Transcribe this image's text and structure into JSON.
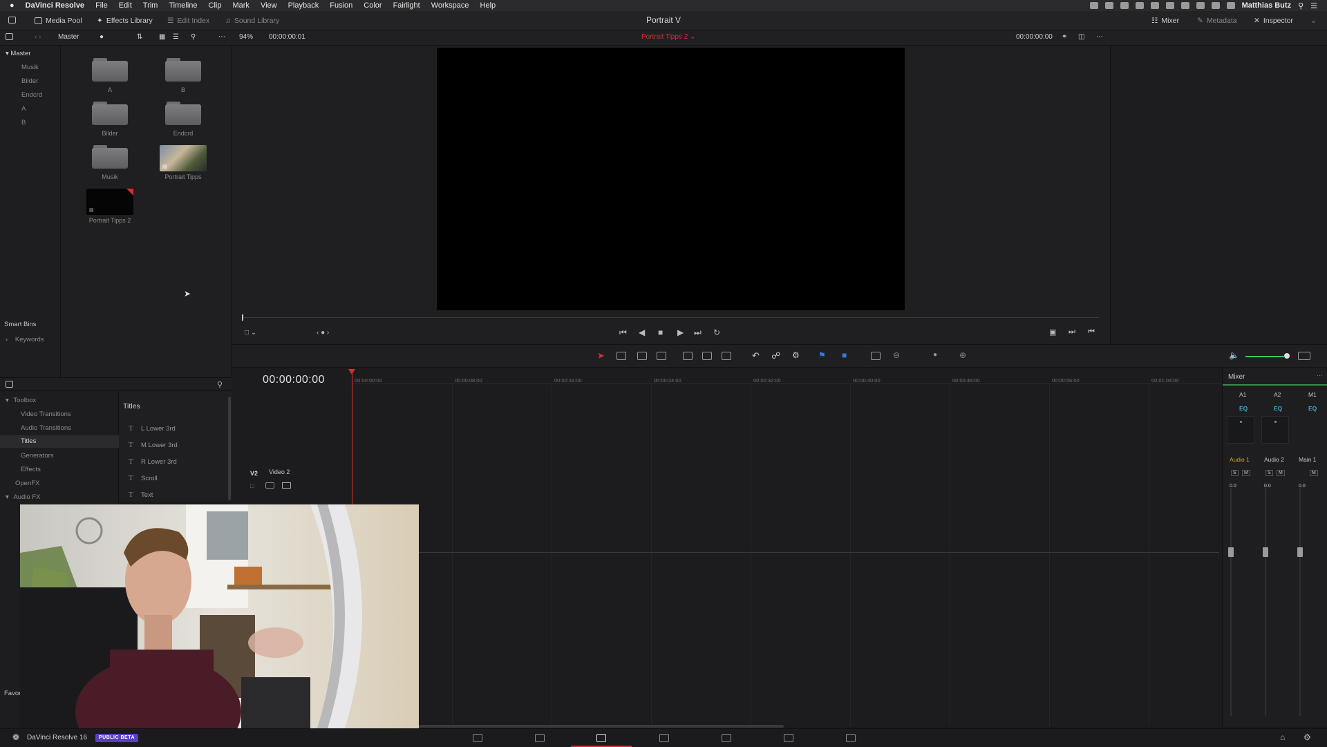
{
  "menubar": {
    "apple": "",
    "app": "DaVinci Resolve",
    "items": [
      "File",
      "Edit",
      "Trim",
      "Timeline",
      "Clip",
      "Mark",
      "View",
      "Playback",
      "Fusion",
      "Color",
      "Fairlight",
      "Workspace",
      "Help"
    ],
    "user": "Matthias Butz"
  },
  "topbar": {
    "media_pool": "Media Pool",
    "effects_library": "Effects Library",
    "edit_index": "Edit Index",
    "sound_library": "Sound Library",
    "project_title": "Portrait V",
    "mixer": "Mixer",
    "metadata": "Metadata",
    "inspector": "Inspector"
  },
  "subbar": {
    "bin_name": "Master",
    "zoom": "94%",
    "source_tc": "00:00:00:01",
    "timeline_name": "Portrait Tipps 2",
    "record_tc": "00:00:00:00"
  },
  "bins": {
    "master": "Master",
    "children": [
      "Musik",
      "Bilder",
      "Endcrd",
      "A",
      "B"
    ],
    "smart_bins": "Smart Bins",
    "keywords": "Keywords"
  },
  "clips": [
    {
      "label": "A",
      "kind": "folder"
    },
    {
      "label": "B",
      "kind": "folder"
    },
    {
      "label": "Bilder",
      "kind": "folder"
    },
    {
      "label": "Endcrd",
      "kind": "folder"
    },
    {
      "label": "Musik",
      "kind": "folder"
    },
    {
      "label": "Portrait Tipps",
      "kind": "video"
    },
    {
      "label": "Portrait Tipps 2",
      "kind": "timeline"
    }
  ],
  "effects": {
    "toolbox": "Toolbox",
    "video_transitions": "Video Transitions",
    "audio_transitions": "Audio Transitions",
    "titles": "Titles",
    "generators": "Generators",
    "effects": "Effects",
    "openfx": "OpenFX",
    "audio_fx": "Audio FX",
    "favorites": "Favor",
    "list_header": "Titles",
    "title_items": [
      "L Lower 3rd",
      "M Lower 3rd",
      "R Lower 3rd",
      "Scroll",
      "Text"
    ]
  },
  "timeline": {
    "timecode": "00:00:00:00",
    "ticks": [
      "00:00:00:00",
      "00:00:08:00",
      "00:00:16:00",
      "00:00:24:00",
      "00:00:32:00",
      "00:00:40:00",
      "00:00:48:00",
      "00:00:56:00",
      "00:01:04:00"
    ],
    "track_id": "V2",
    "track_name": "Video 2"
  },
  "mixer": {
    "title": "Mixer",
    "channels": [
      "A1",
      "A2",
      "M1"
    ],
    "eq": "EQ",
    "strip_names": [
      "Audio 1",
      "Audio 2",
      "Main 1"
    ],
    "values": [
      "0.0",
      "0.0",
      "0.0"
    ],
    "solo": "S",
    "mute": "M"
  },
  "statusbar": {
    "app_name": "DaVinci Resolve 16",
    "badge": "PUBLIC BETA"
  },
  "colors": {
    "accent_red": "#d23030",
    "accent_orange": "#e0a030",
    "accent_teal": "#3ab0c8",
    "beta_purple": "#5a3fbf"
  }
}
